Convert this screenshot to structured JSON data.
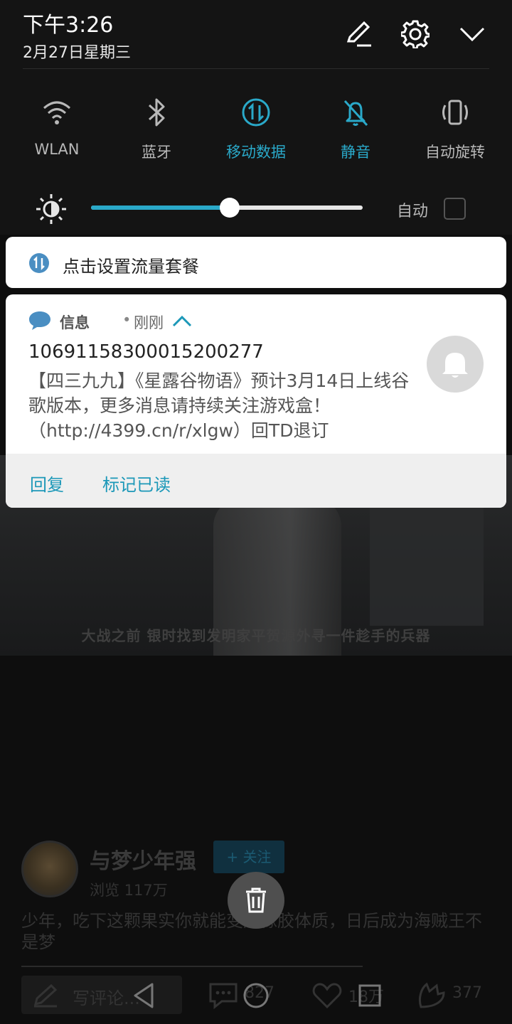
{
  "status": {
    "time": "下午3:26",
    "date": "2月27日星期三"
  },
  "header_icons": [
    "edit-icon",
    "settings-icon",
    "collapse-icon"
  ],
  "quick_tiles": [
    {
      "label": "WLAN",
      "icon": "wifi-icon",
      "active": false
    },
    {
      "label": "蓝牙",
      "icon": "bluetooth-icon",
      "active": false
    },
    {
      "label": "移动数据",
      "icon": "mobile-data-icon",
      "active": true
    },
    {
      "label": "静音",
      "icon": "mute-icon",
      "active": true
    },
    {
      "label": "自动旋转",
      "icon": "auto-rotate-icon",
      "active": false
    }
  ],
  "brightness": {
    "level": 0.51,
    "auto_label": "自动",
    "auto_checked": false
  },
  "data_plan_card": {
    "text": "点击设置流量套餐"
  },
  "message_card": {
    "app": "信息",
    "dot": "•",
    "when": "刚刚",
    "sender": "10691158300015200277",
    "body": "【四三九九】《星露谷物语》预计3月14日上线谷歌版本，更多消息请持续关注游戏盒！（http://4399.cn/r/xlgw）回TD退订",
    "actions": {
      "reply": "回复",
      "mark_read": "标记已读"
    }
  },
  "background_app": {
    "video_subtitle": "大战之前 银时找到发明家平贺源外寻一件趁手的兵器",
    "author": "与梦少年强",
    "follow_label": "+ 关注",
    "views": "浏览 117万",
    "description": "少年，吃下这颗果实你就能变成橡胶体质，日后成为海贼王不是梦",
    "comment_placeholder": "写评论...",
    "comment_count": "827",
    "like_count": "18万",
    "share_count": "377"
  },
  "colors": {
    "accent": "#2aa9c9",
    "action": "#1c98b8",
    "shade_bg": "#141414"
  }
}
